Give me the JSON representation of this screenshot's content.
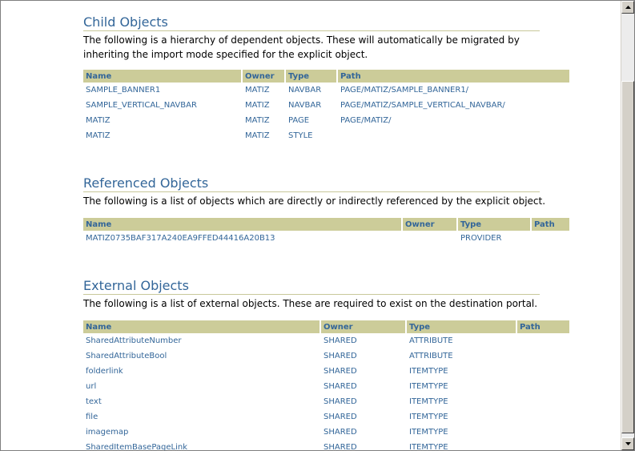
{
  "child_objects": {
    "title": "Child Objects",
    "description": "The following is a hierarchy of dependent objects. These will automatically be migrated by inheriting the import mode specified for the explicit object.",
    "columns": [
      "Name",
      "Owner",
      "Type",
      "Path"
    ],
    "rows": [
      [
        "SAMPLE_BANNER1",
        "MATIZ",
        "NAVBAR",
        "PAGE/MATIZ/SAMPLE_BANNER1/"
      ],
      [
        "SAMPLE_VERTICAL_NAVBAR",
        "MATIZ",
        "NAVBAR",
        "PAGE/MATIZ/SAMPLE_VERTICAL_NAVBAR/"
      ],
      [
        "MATIZ",
        "MATIZ",
        "PAGE",
        "PAGE/MATIZ/"
      ],
      [
        "MATIZ",
        "MATIZ",
        "STYLE",
        ""
      ]
    ]
  },
  "referenced_objects": {
    "title": "Referenced Objects",
    "description": "The following is a list of objects which are directly or indirectly referenced by the explicit object.",
    "columns": [
      "Name",
      "Owner",
      "Type",
      "Path"
    ],
    "rows": [
      [
        "MATIZ0735BAF317A240EA9FFED44416A20B13",
        "",
        "PROVIDER",
        ""
      ]
    ]
  },
  "external_objects": {
    "title": "External Objects",
    "description": "The following is a list of external objects. These are required to exist on the destination portal.",
    "columns": [
      "Name",
      "Owner",
      "Type",
      "Path"
    ],
    "rows": [
      [
        "SharedAttributeNumber",
        "SHARED",
        "ATTRIBUTE",
        ""
      ],
      [
        "SharedAttributeBool",
        "SHARED",
        "ATTRIBUTE",
        ""
      ],
      [
        "folderlink",
        "SHARED",
        "ITEMTYPE",
        ""
      ],
      [
        "url",
        "SHARED",
        "ITEMTYPE",
        ""
      ],
      [
        "text",
        "SHARED",
        "ITEMTYPE",
        ""
      ],
      [
        "file",
        "SHARED",
        "ITEMTYPE",
        ""
      ],
      [
        "imagemap",
        "SHARED",
        "ITEMTYPE",
        ""
      ],
      [
        "SharedItemBasePageLink",
        "SHARED",
        "ITEMTYPE",
        ""
      ]
    ]
  },
  "colors": {
    "heading": "#336699",
    "table_header_bg": "#cccc99",
    "link": "#336699"
  }
}
